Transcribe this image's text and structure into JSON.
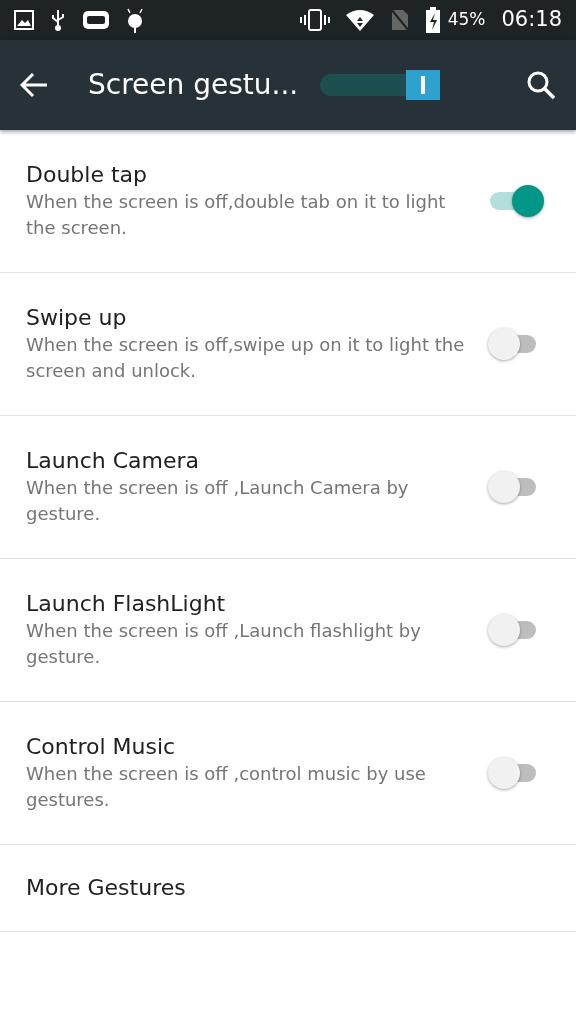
{
  "status_bar": {
    "battery": "45%",
    "time": "06:18"
  },
  "toolbar": {
    "title": "Screen gestu...",
    "master_switch": {
      "on": true
    }
  },
  "settings": [
    {
      "kind": "switch",
      "title": "Double tap",
      "summary": "When the screen is off,double tab on it to light the screen.",
      "on": true
    },
    {
      "kind": "switch",
      "title": "Swipe up",
      "summary": "When the screen is off,swipe up on it to light the screen and unlock.",
      "on": false
    },
    {
      "kind": "switch",
      "title": "Launch Camera",
      "summary": "When the screen is off ,Launch Camera by gesture.",
      "on": false
    },
    {
      "kind": "switch",
      "title": "Launch FlashLight",
      "summary": "When the screen is off ,Launch flashlight by gesture.",
      "on": false
    },
    {
      "kind": "switch",
      "title": "Control Music",
      "summary": "When the screen is off ,control music by use gestures.",
      "on": false
    },
    {
      "kind": "link",
      "title": "More Gestures"
    }
  ]
}
